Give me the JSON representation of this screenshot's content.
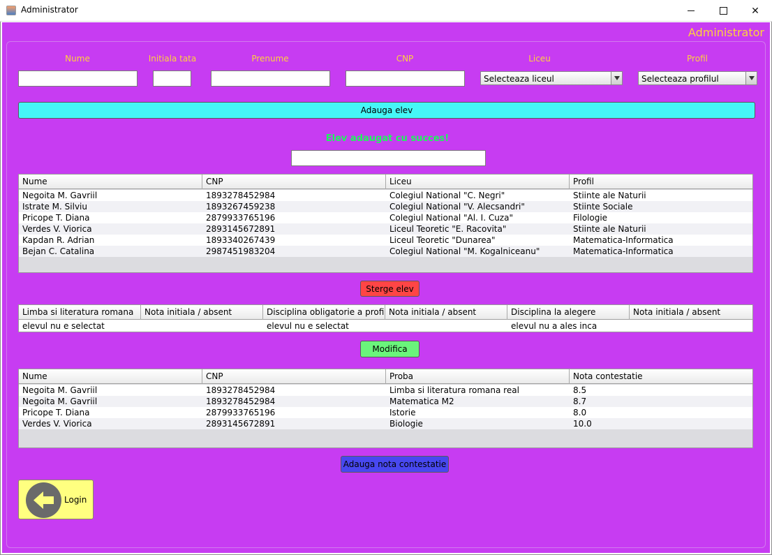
{
  "window": {
    "title": "Administrator",
    "min_glyph": "",
    "close_glyph": "✕"
  },
  "header": {
    "title": "Administrator"
  },
  "form": {
    "labels": {
      "nume": "Nume",
      "initiala": "Initiala tata",
      "prenume": "Prenume",
      "cnp": "CNP",
      "liceu": "Liceu",
      "profil": "Profil"
    },
    "values": {
      "nume": "",
      "initiala": "",
      "prenume": "",
      "cnp": ""
    },
    "liceu_selected": "Selecteaza liceul",
    "profil_selected": "Selecteaza profilul"
  },
  "add_button": "Adauga elev",
  "status": {
    "message": "Elev adaugat cu succes!",
    "field_value": ""
  },
  "students_table": {
    "columns": [
      "Nume",
      "CNP",
      "Liceu",
      "Profil"
    ],
    "rows": [
      [
        "Negoita M. Gavriil",
        "1893278452984",
        "Colegiul National \"C. Negri\"",
        "Stiinte ale Naturii"
      ],
      [
        "Istrate M. Silviu",
        "1893267459238",
        "Colegiul National \"V. Alecsandri\"",
        "Stiinte Sociale"
      ],
      [
        "Pricope T. Diana",
        "2879933765196",
        "Colegiul National \"Al. I. Cuza\"",
        "Filologie"
      ],
      [
        "Verdes V. Viorica",
        "2893145672891",
        "Liceul Teoretic \"E. Racovita\"",
        "Stiinte ale Naturii"
      ],
      [
        "Kapdan R. Adrian",
        "1893340267439",
        "Liceul Teoretic \"Dunarea\"",
        "Matematica-Informatica"
      ],
      [
        "Bejan C. Catalina",
        "2987451983204",
        "Colegiul National \"M. Kogalniceanu\"",
        "Matematica-Informatica"
      ]
    ]
  },
  "delete_button": "Sterge elev",
  "grades_table": {
    "columns": [
      "Limba si literatura romana",
      "Nota initiala / absent",
      "Disciplina obligatorie a profil...",
      "Nota initiala / absent",
      "Disciplina la alegere",
      "Nota initiala / absent"
    ],
    "rows": [
      [
        "elevul nu e selectat",
        "",
        "elevul nu e selectat",
        "",
        "elevul nu a ales inca",
        ""
      ]
    ]
  },
  "modify_button": "Modifica",
  "appeals_table": {
    "columns": [
      "Nume",
      "CNP",
      "Proba",
      "Nota contestatie"
    ],
    "rows": [
      [
        "Negoita M. Gavriil",
        "1893278452984",
        "Limba si literatura romana real",
        "8.5"
      ],
      [
        "Negoita M. Gavriil",
        "1893278452984",
        "Matematica M2",
        "8.7"
      ],
      [
        "Pricope T. Diana",
        "2879933765196",
        "Istorie",
        "8.0"
      ],
      [
        "Verdes V. Viorica",
        "2893145672891",
        "Biologie",
        "10.0"
      ]
    ]
  },
  "contest_button": "Adauga nota contestatie",
  "login_button": {
    "label": "Login",
    "icon": "back-arrow-icon"
  },
  "colors": {
    "background": "#c73cf2",
    "label": "#ffd23c",
    "success": "#1ef55c",
    "add_button": "#45f7f7",
    "delete_button": "#ff4545",
    "modify_button": "#6af57b",
    "contest_button": "#4848f0",
    "login_button": "#ffff80"
  }
}
